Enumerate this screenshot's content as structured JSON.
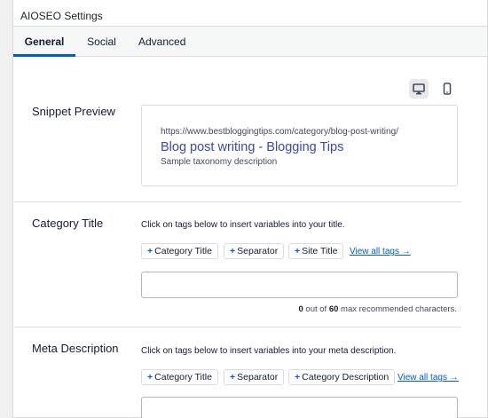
{
  "header": {
    "title": "AIOSEO Settings"
  },
  "tabs": [
    {
      "label": "General",
      "active": true
    },
    {
      "label": "Social",
      "active": false
    },
    {
      "label": "Advanced",
      "active": false
    }
  ],
  "preview_devices": [
    {
      "icon": "desktop-icon",
      "selected": true
    },
    {
      "icon": "mobile-icon",
      "selected": false
    }
  ],
  "snippet_preview": {
    "label": "Snippet Preview",
    "url": "https://www.bestbloggingtips.com/category/blog-post-writing/",
    "title": "Blog post writing - Blogging Tips",
    "description": "Sample taxonomy description"
  },
  "category_title": {
    "label": "Category Title",
    "hint": "Click on tags below to insert variables into your title.",
    "tags": [
      "Category Title",
      "Separator",
      "Site Title"
    ],
    "view_all": "View all tags →",
    "value": "",
    "counter": {
      "count": "0",
      "mid": " out of ",
      "max": "60",
      "suffix": " max recommended characters."
    }
  },
  "meta_description": {
    "label": "Meta Description",
    "hint": "Click on tags below to insert variables into your meta description.",
    "tags": [
      "Category Title",
      "Separator",
      "Category Description"
    ],
    "view_all": "View all tags →",
    "value": ""
  },
  "colors": {
    "accent": "#005ae0",
    "link_title": "#3b48b5",
    "border": "#dcdcde"
  }
}
